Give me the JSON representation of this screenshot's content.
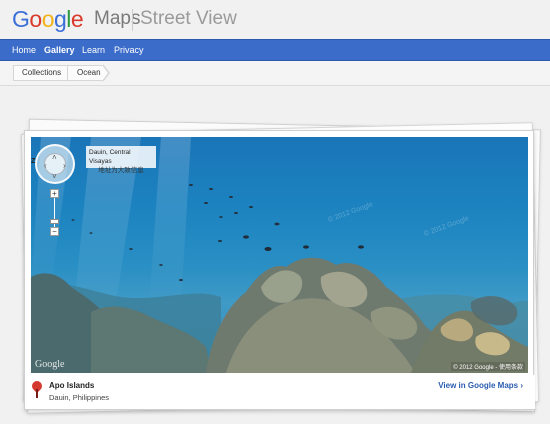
{
  "header": {
    "logo": "Google",
    "product": "Maps",
    "section": "Street View"
  },
  "nav": {
    "items": [
      {
        "label": "Home",
        "active": false
      },
      {
        "label": "Gallery",
        "active": true
      },
      {
        "label": "Learn",
        "active": false
      },
      {
        "label": "Privacy",
        "active": false
      }
    ]
  },
  "breadcrumb": {
    "items": [
      {
        "label": "Collections"
      },
      {
        "label": "Ocean"
      }
    ]
  },
  "viewer": {
    "location_line1": "Dauin, Central Visayas",
    "location_line2": "地址为大致信息",
    "compass_label": "Z",
    "zoom_in": "+",
    "zoom_out": "−",
    "watermark": "Google",
    "copyright": "© 2012 Google - 使用条款",
    "imagery_watermark": "© 2012 Google"
  },
  "info": {
    "title": "Apo Islands",
    "subtitle": "Dauin, Philippines",
    "link": "View in Google Maps ›"
  },
  "colors": {
    "nav_bg": "#3b6cc9",
    "link": "#2a5db0",
    "pin": "#d43a2f",
    "water": "#1c83c0"
  }
}
